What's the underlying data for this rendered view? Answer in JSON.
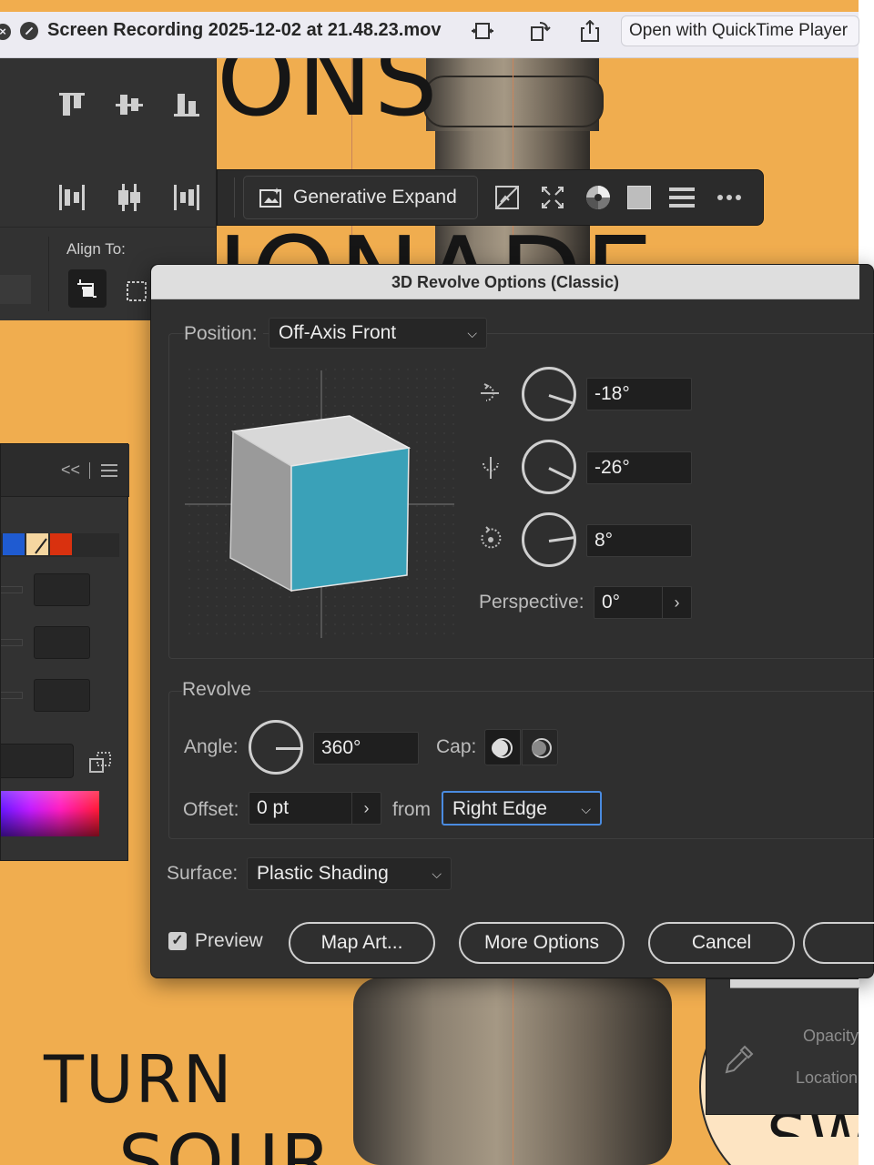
{
  "titlebar": {
    "title": "Screen Recording 2025-12-02 at 21.48.23.mov",
    "open_with_label": "Open with QuickTime Player",
    "icons": [
      "close-icon",
      "stop-icon",
      "trim-icon",
      "rotate-icon",
      "share-icon"
    ]
  },
  "artboard": {
    "heading_top_fragment": "ONS",
    "heading_mid_fragment": "IONADE",
    "bottom_word_1": "TURN",
    "bottom_word_2": "SOUR",
    "side_word": "SW",
    "background_color": "#f0ad4f"
  },
  "align_panel": {
    "align_to_label": "Align To:",
    "icons": [
      "align-top-icon",
      "align-vcenter-icon",
      "align-bottom-icon",
      "distribute-left-icon",
      "distribute-hcenter-icon",
      "distribute-right-icon",
      "align-to-selection-icon",
      "align-to-artboard-icon"
    ]
  },
  "taskbar": {
    "generative_expand_label": "Generative Expand",
    "icons": [
      "generative-expand-icon",
      "crop-image-icon",
      "transform-icon",
      "recolor-icon",
      "fill-swatch-icon",
      "stroke-lines-icon",
      "more-icon"
    ]
  },
  "swatches_panel": {
    "collapse_glyph": "<<",
    "swatch_colors": [
      "#1f5bd1",
      "#f5d6a0",
      "#d9310f"
    ]
  },
  "dialog": {
    "title": "3D Revolve Options (Classic)",
    "position_label": "Position:",
    "position_value": "Off-Axis Front",
    "rotation_x": "-18°",
    "rotation_y": "-26°",
    "rotation_z": "8°",
    "perspective_label": "Perspective:",
    "perspective_value": "0°",
    "revolve_group_label": "Revolve",
    "angle_label": "Angle:",
    "angle_value": "360°",
    "cap_label": "Cap:",
    "offset_label": "Offset:",
    "offset_value": "0 pt",
    "from_label": "from",
    "from_value": "Right Edge",
    "surface_label": "Surface:",
    "surface_value": "Plastic Shading",
    "preview_label": "Preview",
    "preview_checked": true,
    "map_art_label": "Map Art...",
    "more_options_label": "More Options",
    "cancel_label": "Cancel",
    "cube_front_color": "#3aa1b8",
    "accent_color": "#4a8be0"
  },
  "gradient_panel": {
    "opacity_label": "Opacity",
    "location_label": "Location"
  }
}
